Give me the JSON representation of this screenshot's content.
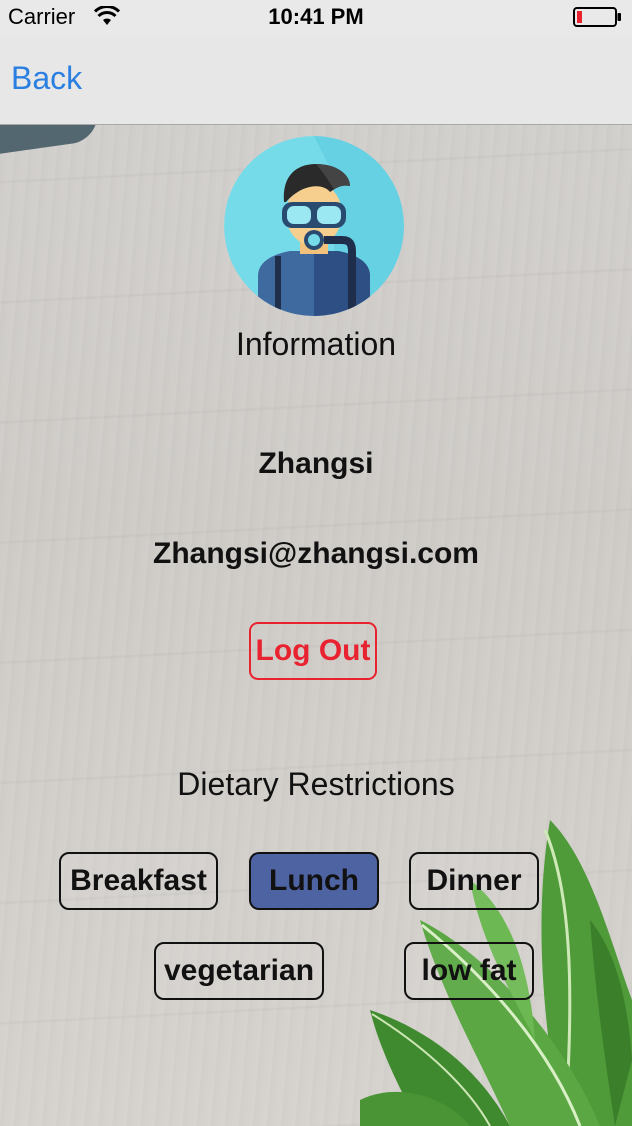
{
  "status_bar": {
    "carrier": "Carrier",
    "time": "10:41 PM",
    "battery_color": "#e8232f"
  },
  "nav": {
    "back_label": "Back",
    "accent": "#2a7fe0"
  },
  "profile": {
    "avatar_icon": "diver-avatar-icon",
    "title": "Information",
    "name": "Zhangsi",
    "email": "Zhangsi@zhangsi.com",
    "logout_label": "Log Out",
    "logout_color": "#e8232f"
  },
  "dietary": {
    "title": "Dietary Restrictions",
    "options": [
      {
        "label": "Breakfast",
        "selected": false
      },
      {
        "label": "Lunch",
        "selected": true
      },
      {
        "label": "Dinner",
        "selected": false
      },
      {
        "label": "vegetarian",
        "selected": false
      },
      {
        "label": "low fat",
        "selected": false
      }
    ],
    "selected_color": "#4e63a1"
  }
}
